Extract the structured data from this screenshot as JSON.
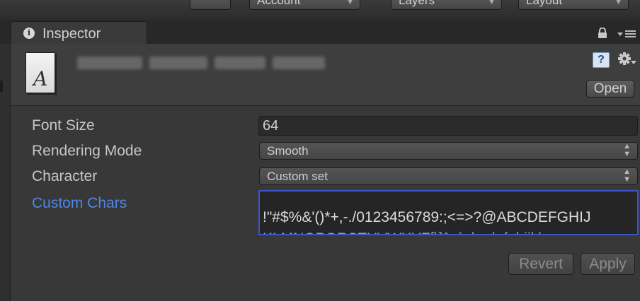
{
  "toolbar": {
    "account_label": "Account",
    "layers_label": "Layers",
    "layout_label": "Layout"
  },
  "tab": {
    "label": "Inspector"
  },
  "header": {
    "asset_glyph": "A",
    "open_label": "Open",
    "icons": [
      "font-asset-icon",
      "help-book-icon",
      "gear-icon",
      "lock-icon",
      "menu-icon"
    ]
  },
  "properties": {
    "font_size": {
      "label": "Font Size",
      "value": "64"
    },
    "rendering_mode": {
      "label": "Rendering Mode",
      "value": "Smooth"
    },
    "character": {
      "label": "Character",
      "value": "Custom set"
    },
    "custom_chars": {
      "label": "Custom Chars",
      "value": "!\"#$%&'()*+,-./0123456789:;<=>?@ABCDEFGHIJ"
    }
  },
  "actions": {
    "revert_label": "Revert",
    "apply_label": "Apply"
  },
  "colors": {
    "active_label": "#4f86e8",
    "focus_border": "#3d55c8",
    "panel_bg": "#383838"
  }
}
